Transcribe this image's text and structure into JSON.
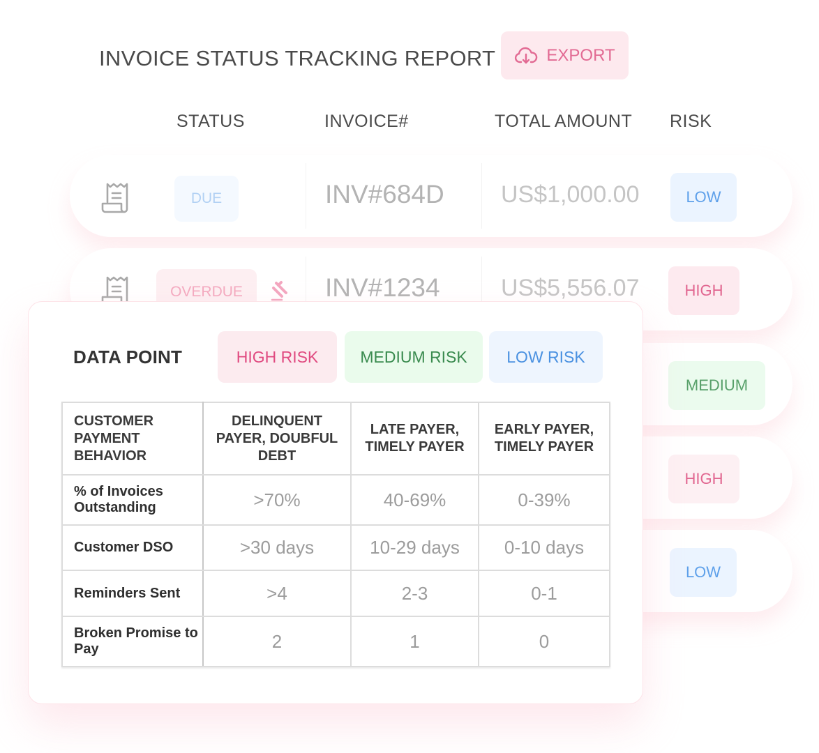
{
  "header": {
    "title": "INVOICE STATUS TRACKING REPORT",
    "export_label": "EXPORT",
    "export_icon": "cloud-download-icon"
  },
  "columns": [
    "STATUS",
    "INVOICE#",
    "TOTAL AMOUNT",
    "RISK"
  ],
  "invoices": [
    {
      "status": "DUE",
      "invoice": "INV#684D",
      "amount": "US$1,000.00",
      "risk": "LOW"
    },
    {
      "status": "OVERDUE",
      "invoice": "INV#1234",
      "amount": "US$5,556.07",
      "risk": "HIGH",
      "flag_icon": "gavel-icon"
    },
    {
      "risk": "MEDIUM"
    },
    {
      "risk": "HIGH"
    },
    {
      "risk": "LOW"
    }
  ],
  "colors": {
    "high": "#e04a80",
    "medium": "#3a8b4f",
    "low": "#4a91e1",
    "export": "#e26a93"
  },
  "risk_card": {
    "title": "DATA POINT",
    "legend": [
      "HIGH RISK",
      "MEDIUM RISK",
      "LOW RISK"
    ],
    "table": {
      "headers": [
        "CUSTOMER PAYMENT BEHAVIOR",
        "DELINQUENT PAYER, DOUBFUL DEBT",
        "LATE PAYER, TIMELY PAYER",
        "EARLY PAYER, TIMELY PAYER"
      ],
      "rows": [
        {
          "label": "% of Invoices Outstanding",
          "high": ">70%",
          "medium": "40-69%",
          "low": "0-39%"
        },
        {
          "label": "Customer DSO",
          "high": ">30 days",
          "medium": "10-29 days",
          "low": "0-10 days"
        },
        {
          "label": "Reminders Sent",
          "high": ">4",
          "medium": "2-3",
          "low": "0-1"
        },
        {
          "label": "Broken Promise to Pay",
          "high": "2",
          "medium": "1",
          "low": "0"
        }
      ]
    }
  }
}
